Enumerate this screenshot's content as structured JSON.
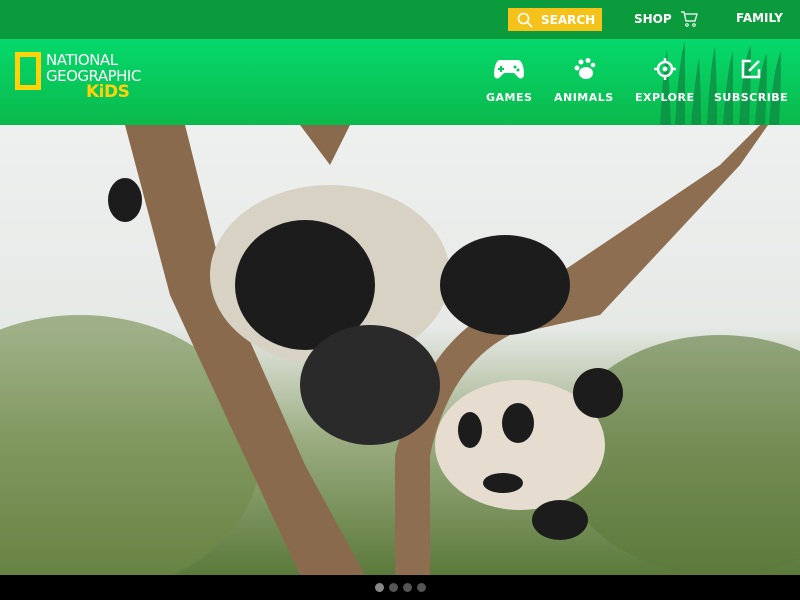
{
  "topbar": {
    "search_label": "SEARCH",
    "shop_label": "SHOP",
    "family_label": "FAMILY"
  },
  "logo": {
    "line1": "NATIONAL",
    "line2": "GEOGRAPHIC",
    "line3": "KiDS"
  },
  "nav": [
    {
      "label": "GAMES",
      "icon": "gamepad-icon"
    },
    {
      "label": "ANIMALS",
      "icon": "paw-icon"
    },
    {
      "label": "EXPLORE",
      "icon": "crosshair-icon"
    },
    {
      "label": "SUBSCRIBE",
      "icon": "edit-icon"
    }
  ],
  "carousel": {
    "slide_count": 4,
    "active_index": 0
  },
  "colors": {
    "topbar": "#0b9a3c",
    "nav": "#05d96c",
    "search": "#f5c21b",
    "logo_yellow": "#ffd20a"
  }
}
